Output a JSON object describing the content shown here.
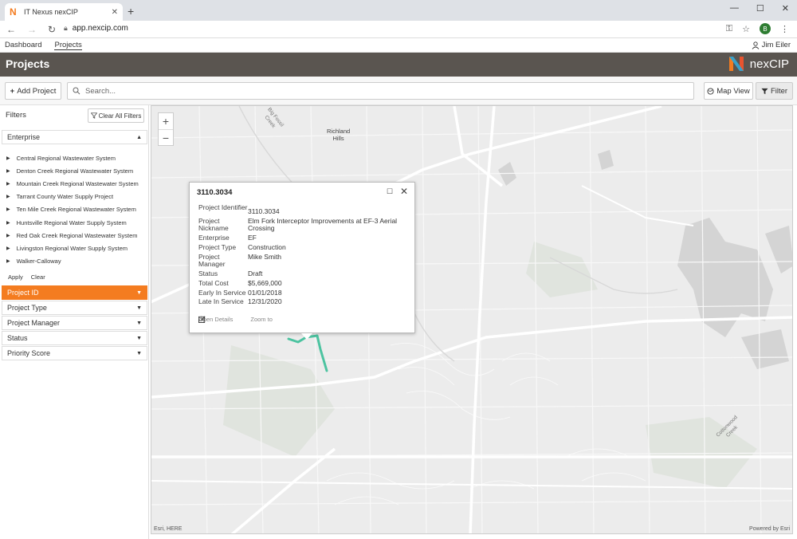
{
  "browser": {
    "tab_title": "IT Nexus nexCIP",
    "url": "app.nexcip.com",
    "profile_initial": "B"
  },
  "nav": {
    "dashboard": "Dashboard",
    "projects": "Projects",
    "user_name": "Jim Eiler"
  },
  "header": {
    "title": "Projects",
    "brand": "nexCIP"
  },
  "toolbar": {
    "add_project": "Add Project",
    "search_placeholder": "Search...",
    "map_view": "Map View",
    "filter": "Filter"
  },
  "sidebar": {
    "filters_label": "Filters",
    "clear_all": "Clear All Filters",
    "enterprise_label": "Enterprise",
    "enterprises": [
      "Central Regional Wastewater System",
      "Denton Creek Regional Wastewater System",
      "Mountain Creek Regional Wastewater System",
      "Tarrant County Water Supply Project",
      "Ten Mile Creek Regional Wastewater System",
      "Huntsville Regional Water Supply System",
      "Red Oak Creek Regional Wastewater System",
      "Livingston Regional Water Supply System",
      "Walker-Calloway"
    ],
    "apply": "Apply",
    "clear": "Clear",
    "sections": [
      "Project ID",
      "Project Type",
      "Project Manager",
      "Status",
      "Priority Score"
    ]
  },
  "map": {
    "labels": {
      "richland": "Richland\nHills",
      "big_fossil": "Big Fossil\nCreek",
      "cottonwood": "Cottonwood\nCreek"
    },
    "attribution_left": "Esri, HERE",
    "attribution_right": "Powered by Esri"
  },
  "popup": {
    "title": "3110.3034",
    "fields": [
      {
        "key": "Project Identifier",
        "value": "3110.3034"
      },
      {
        "key": "Project Nickname",
        "value": "Elm Fork Interceptor Improvements at EF-3 Aerial Crossing"
      },
      {
        "key": "Enterprise",
        "value": "EF"
      },
      {
        "key": "Project Type",
        "value": "Construction"
      },
      {
        "key": "Project Manager",
        "value": "Mike Smith"
      },
      {
        "key": "Status",
        "value": "Draft"
      },
      {
        "key": "Total Cost",
        "value": "$5,669,000"
      },
      {
        "key": "Early In Service",
        "value": "01/01/2018"
      },
      {
        "key": "Late In Service",
        "value": "12/31/2020"
      }
    ],
    "open_details": "Open Details",
    "zoom_to": "Zoom to"
  },
  "colors": {
    "accent": "#f47c20",
    "header_bg": "#5a5550",
    "route": "#4cc3a0"
  }
}
